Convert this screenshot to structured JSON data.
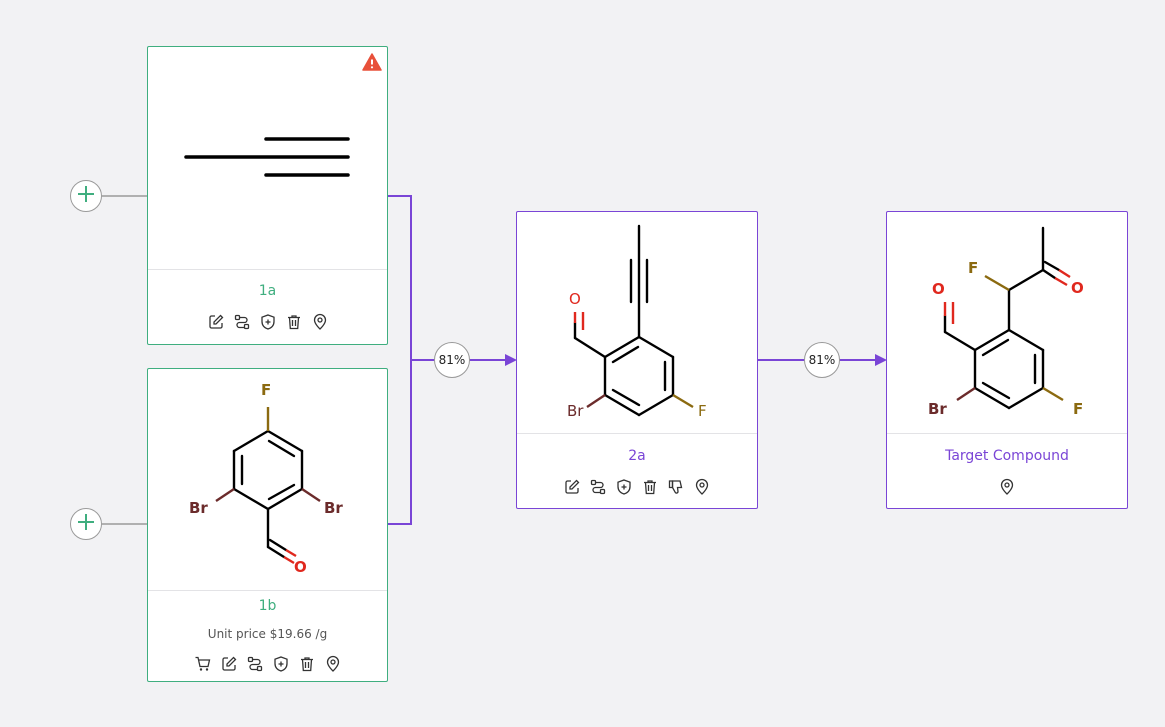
{
  "colors": {
    "starting_material": "#3fae7f",
    "intermediate": "#7a45d6",
    "warning": "#e8503a",
    "connector": "#7a45d6",
    "add_connector": "#9a9a9a"
  },
  "add_buttons": [
    {
      "icon": "plus-icon"
    },
    {
      "icon": "plus-icon"
    }
  ],
  "nodes": {
    "n1a": {
      "label": "1a",
      "warning_icon": "warning-triangle-icon",
      "actions": [
        "edit-icon",
        "route-icon",
        "shield-plus-icon",
        "trash-icon",
        "location-pin-icon"
      ]
    },
    "n1b": {
      "label": "1b",
      "price": "Unit price $19.66 /g",
      "atoms": {
        "f": "F",
        "br1": "Br",
        "br2": "Br",
        "o": "O"
      },
      "actions": [
        "cart-icon",
        "edit-icon",
        "route-icon",
        "shield-plus-icon",
        "trash-icon",
        "location-pin-icon"
      ]
    },
    "n2a": {
      "label": "2a",
      "atoms": {
        "o": "O",
        "br": "Br",
        "f": "F"
      },
      "actions": [
        "edit-icon",
        "route-icon",
        "shield-plus-icon",
        "trash-icon",
        "thumbs-down-icon",
        "location-pin-icon"
      ]
    },
    "target": {
      "label": "Target Compound",
      "atoms": {
        "f1": "F",
        "o1": "O",
        "o2": "O",
        "br": "Br",
        "f2": "F"
      },
      "actions": [
        "location-pin-icon"
      ]
    }
  },
  "reactions": [
    {
      "yield": "81%"
    },
    {
      "yield": "81%"
    }
  ]
}
